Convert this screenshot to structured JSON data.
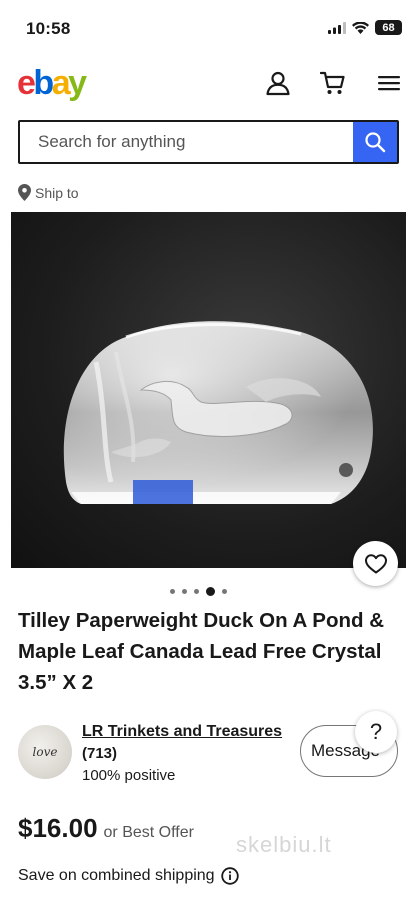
{
  "status": {
    "time": "10:58",
    "battery": "68"
  },
  "header": {
    "logo_e": "e",
    "logo_b": "b",
    "logo_a": "a",
    "logo_y": "y"
  },
  "search": {
    "placeholder": "Search for anything"
  },
  "ship_to": {
    "label": "Ship to"
  },
  "gallery": {
    "image_count": 5,
    "active_index": 3
  },
  "listing": {
    "title": "Tilley Paperweight Duck On A Pond & Maple Leaf Canada Lead Free Crystal 3.5” X 2",
    "price": "$16.00",
    "best_offer": "or Best Offer",
    "shipping": "Save on combined shipping"
  },
  "seller": {
    "avatar_text": "love",
    "name": "LR Trinkets and Treasures",
    "feedback_count": "(713)",
    "positive": "100% positive",
    "message_label": "Message"
  },
  "help": {
    "label": "?"
  },
  "watermark": {
    "text": "skelbiu.lt"
  },
  "colors": {
    "accent": "#3665f3",
    "text": "#191919",
    "logo_red": "#e53238",
    "logo_blue": "#0064d2",
    "logo_yellow": "#f5af02",
    "logo_green": "#86b817"
  }
}
